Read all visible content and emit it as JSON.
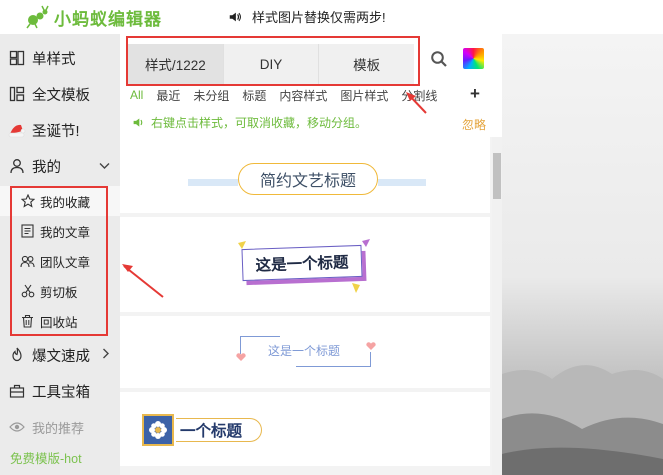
{
  "app": {
    "logo_text": "小蚂蚁编辑器",
    "notice": "样式图片替换仅需两步!"
  },
  "sidebar": {
    "items": [
      {
        "label": "单样式",
        "icon": "brush-icon"
      },
      {
        "label": "全文模板",
        "icon": "layout-icon"
      },
      {
        "label": "圣诞节!",
        "icon": "santa-hat-icon"
      },
      {
        "label": "我的",
        "icon": "user-icon"
      }
    ],
    "my_sub": [
      {
        "label": "我的收藏",
        "icon": "star-icon"
      },
      {
        "label": "我的文章",
        "icon": "document-icon"
      },
      {
        "label": "团队文章",
        "icon": "team-icon"
      },
      {
        "label": "剪切板",
        "icon": "scissors-icon"
      },
      {
        "label": "回收站",
        "icon": "trash-icon"
      }
    ],
    "lower": [
      {
        "label": "爆文速成",
        "icon": "fire-icon"
      },
      {
        "label": "工具宝箱",
        "icon": "toolbox-icon"
      }
    ],
    "recommend": "我的推荐",
    "free_template": "免费模版-hot"
  },
  "tabs": [
    "样式/1222",
    "DIY",
    "模板"
  ],
  "categories": [
    "All",
    "最近",
    "未分组",
    "标题",
    "内容样式",
    "图片样式",
    "分割线"
  ],
  "tip": "右键点击样式，可取消收藏，移动分组。",
  "favorite_label": "忽略",
  "styles": [
    {
      "title": "简约文艺标题"
    },
    {
      "title": "这是一个标题"
    },
    {
      "title": "这是一个标题"
    },
    {
      "title": "一个标题"
    }
  ],
  "colors": {
    "brand_green": "#6dbb3c",
    "annotation_red": "#e53935",
    "favorite_orange": "#e4a43c"
  }
}
